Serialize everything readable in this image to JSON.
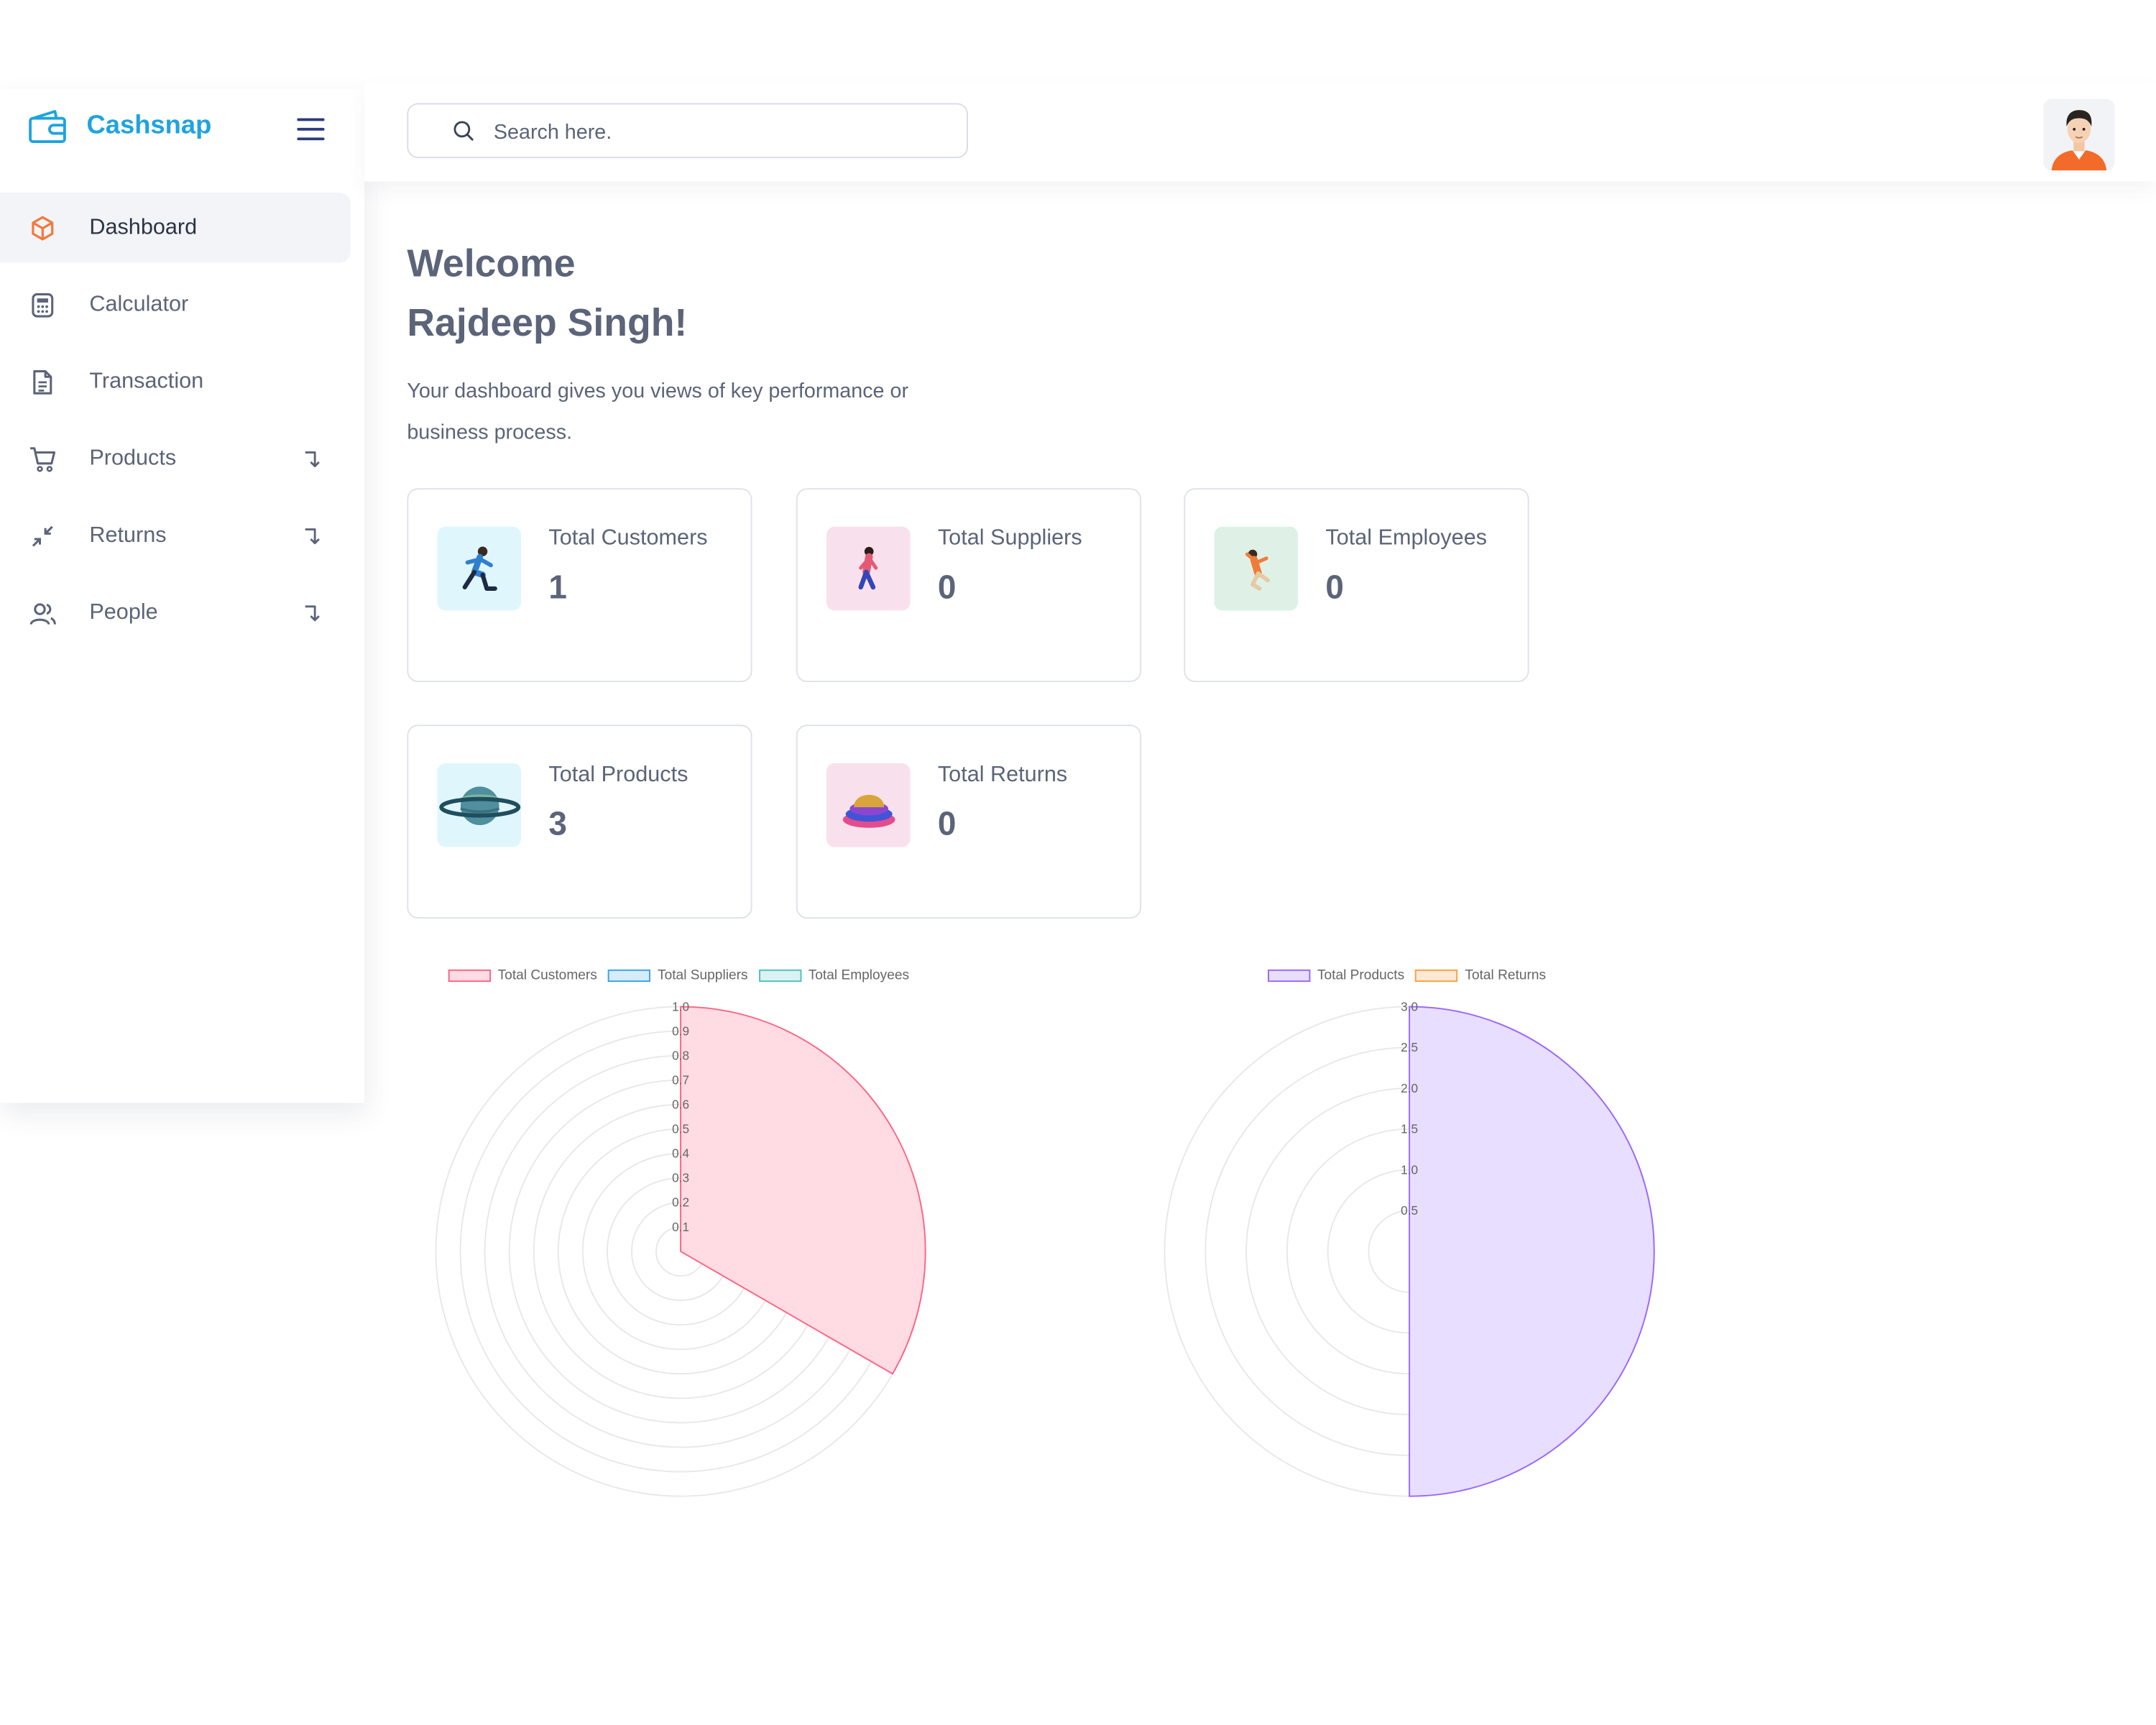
{
  "app": {
    "name": "Cashsnap",
    "accent": "#1fa3e0"
  },
  "sidebar": {
    "items": [
      {
        "label": "Dashboard",
        "icon": "cube-icon",
        "active": true,
        "expandable": false
      },
      {
        "label": "Calculator",
        "icon": "calculator-icon",
        "active": false,
        "expandable": false
      },
      {
        "label": "Transaction",
        "icon": "document-icon",
        "active": false,
        "expandable": false
      },
      {
        "label": "Products",
        "icon": "cart-icon",
        "active": false,
        "expandable": true
      },
      {
        "label": "Returns",
        "icon": "shrink-arrows-icon",
        "active": false,
        "expandable": true
      },
      {
        "label": "People",
        "icon": "users-icon",
        "active": false,
        "expandable": true
      }
    ]
  },
  "header": {
    "search_placeholder": "Search here."
  },
  "welcome": {
    "line1": "Welcome",
    "line2": "Rajdeep Singh!",
    "description": "Your dashboard gives you views of key performance or business process."
  },
  "cards": [
    {
      "title": "Total Customers",
      "value": "1",
      "icon": "running-person-icon",
      "bg": "#e0f6fd"
    },
    {
      "title": "Total Suppliers",
      "value": "0",
      "icon": "walking-person-icon",
      "bg": "#f8e1ec"
    },
    {
      "title": "Total Employees",
      "value": "0",
      "icon": "jumping-person-icon",
      "bg": "#dff1e6"
    },
    {
      "title": "Total Products",
      "value": "3",
      "icon": "planet-icon",
      "bg": "#e0f6fd"
    },
    {
      "title": "Total Returns",
      "value": "0",
      "icon": "stacked-rings-icon",
      "bg": "#f8e1ec"
    }
  ],
  "chart_data": [
    {
      "type": "polarArea",
      "categories": [
        "Total Customers",
        "Total Suppliers",
        "Total Employees"
      ],
      "values": [
        1,
        0,
        0
      ],
      "colors": [
        "#ff6384",
        "#36a2eb",
        "#4bc0c0"
      ],
      "fills": [
        "#ffdce3",
        "#d7ecfb",
        "#dbf2f2"
      ],
      "r_ticks": [
        "0.1",
        "0.2",
        "0.3",
        "0.4",
        "0.5",
        "0.6",
        "0.7",
        "0.8",
        "0.9",
        "1.0"
      ],
      "r_max": 1.0,
      "legend": "top"
    },
    {
      "type": "polarArea",
      "categories": [
        "Total Products",
        "Total Returns"
      ],
      "values": [
        3,
        0
      ],
      "colors": [
        "#9966ff",
        "#ff9f40"
      ],
      "fills": [
        "#e8deff",
        "#ffe9d4"
      ],
      "r_ticks": [
        "0.5",
        "1.0",
        "1.5",
        "2.0",
        "2.5",
        "3.0"
      ],
      "r_max": 3.0,
      "legend": "top"
    }
  ]
}
